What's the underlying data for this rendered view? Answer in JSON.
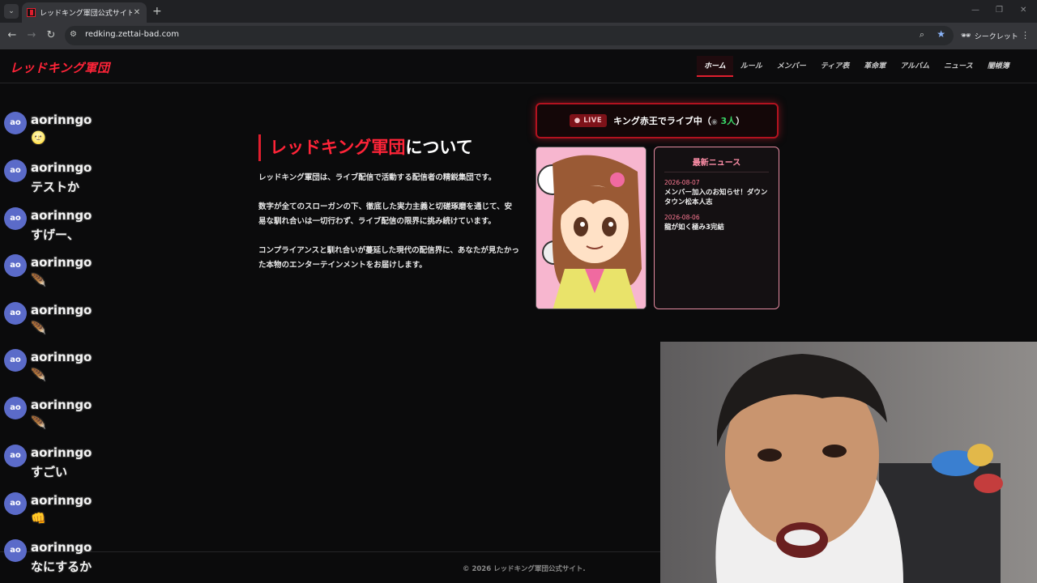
{
  "browser": {
    "tab_title": "レッドキング軍団公式サイト",
    "url": "redking.zettai-bad.com",
    "incognito_label": "シークレット",
    "icons": {
      "tab_list": "chevron-down-icon",
      "close": "close-icon",
      "new_tab": "plus-icon",
      "back": "arrow-left-icon",
      "forward": "arrow-right-icon",
      "reload": "reload-icon",
      "site_info": "tune-icon",
      "zoom": "magnifier-icon",
      "bookmark": "star-icon",
      "incognito": "incognito-icon",
      "menu": "kebab-menu-icon"
    }
  },
  "site": {
    "logo": "レッドキング軍団",
    "nav": [
      "ホーム",
      "ルール",
      "メンバー",
      "ティア表",
      "革命軍",
      "アルバム",
      "ニュース",
      "闇帳簿"
    ],
    "active_nav": "ホーム",
    "about": {
      "title_red": "レッドキング軍団",
      "title_white": "について",
      "p1": "レッドキング軍団は、ライブ配信で活動する配信者の精鋭集団です。",
      "p2": "数字が全てのスローガンの下、徹底した実力主義と切磋琢磨を通じて、安易な馴れ合いは一切行わず、ライブ配信の限界に挑み続けています。",
      "p3": "コンプライアンスと馴れ合いが蔓延した現代の配信界に、あなたが見たかった本物のエンターテインメントをお届けします。"
    },
    "live": {
      "badge": "LIVE",
      "text": "キング赤王でライブ中（",
      "viewers": "3人",
      "close_paren": "）"
    },
    "news": {
      "heading": "最新ニュース",
      "items": [
        {
          "date": "2026-08-07",
          "title": "メンバー加入のお知らせ！ダウンタウン松本人志"
        },
        {
          "date": "2026-08-06",
          "title": "龍が如く極み3完結"
        }
      ]
    },
    "footer": "© 2026 レッドキング軍団公式サイト."
  },
  "chat": [
    {
      "avatar": "ao",
      "user": "aorinngo",
      "text": "🌝"
    },
    {
      "avatar": "ao",
      "user": "aorinngo",
      "text": "テストか"
    },
    {
      "avatar": "ao",
      "user": "aorinngo",
      "text": "すげー、"
    },
    {
      "avatar": "ao",
      "user": "aorinngo",
      "text": "🪶"
    },
    {
      "avatar": "ao",
      "user": "aorinngo",
      "text": "🪶"
    },
    {
      "avatar": "ao",
      "user": "aorinngo",
      "text": "🪶"
    },
    {
      "avatar": "ao",
      "user": "aorinngo",
      "text": "🪶"
    },
    {
      "avatar": "ao",
      "user": "aorinngo",
      "text": "すごい"
    },
    {
      "avatar": "ao",
      "user": "aorinngo",
      "text": "👊"
    },
    {
      "avatar": "ao",
      "user": "aorinngo",
      "text": "なにするか"
    }
  ],
  "colors": {
    "accent": "#e01e2e",
    "logo_red": "#ff2438",
    "live_green": "#39d466",
    "news_pink": "#ff8fa8"
  }
}
